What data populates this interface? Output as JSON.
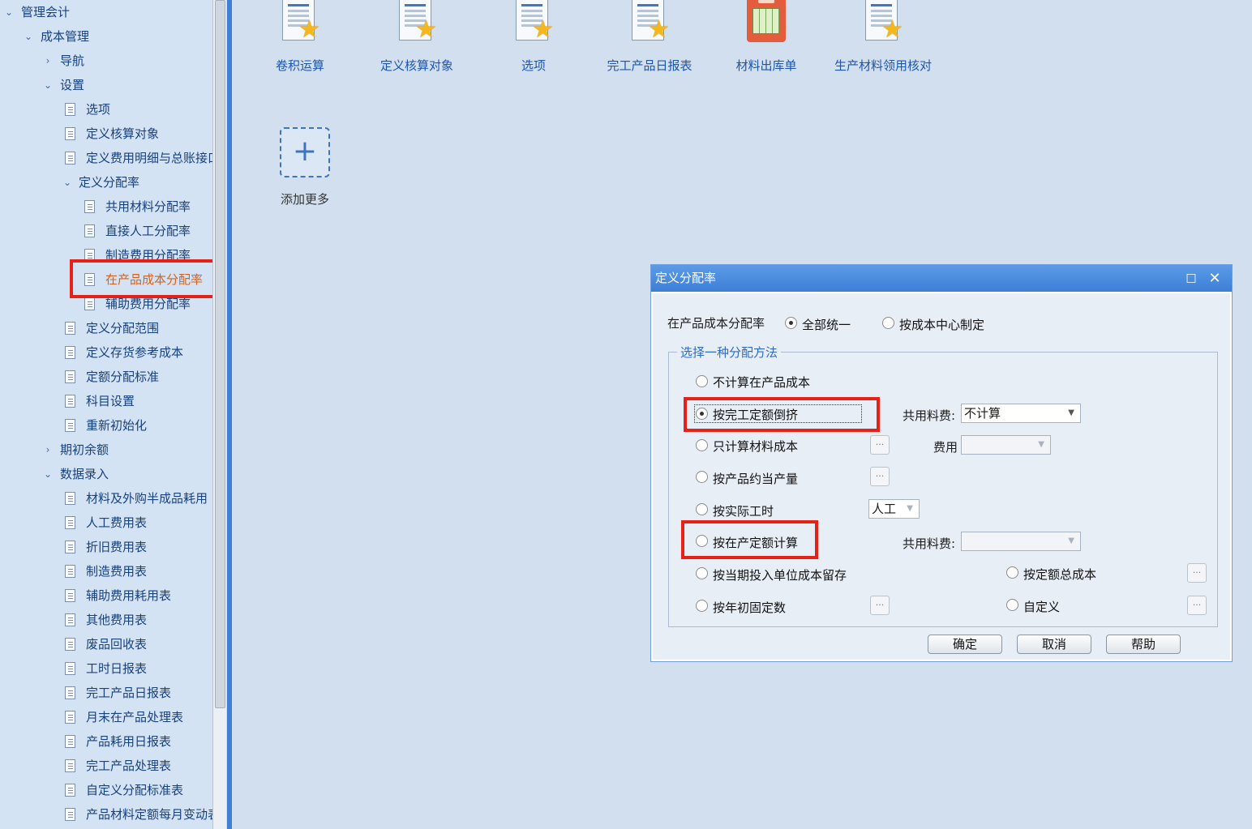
{
  "sidebar": {
    "items": [
      {
        "label": "管理会计",
        "arrow": "⌄"
      },
      {
        "label": "成本管理",
        "arrow": "⌄"
      },
      {
        "label": "导航",
        "arrow": "›"
      },
      {
        "label": "设置",
        "arrow": "⌄"
      },
      {
        "label": "选项"
      },
      {
        "label": "定义核算对象"
      },
      {
        "label": "定义费用明细与总账接口"
      },
      {
        "label": "定义分配率",
        "arrow": "⌄"
      },
      {
        "label": "共用材料分配率"
      },
      {
        "label": "直接人工分配率"
      },
      {
        "label": "制造费用分配率"
      },
      {
        "label": "在产品成本分配率"
      },
      {
        "label": "辅助费用分配率"
      },
      {
        "label": "定义分配范围"
      },
      {
        "label": "定义存货参考成本"
      },
      {
        "label": "定额分配标准"
      },
      {
        "label": "科目设置"
      },
      {
        "label": "重新初始化"
      },
      {
        "label": "期初余额",
        "arrow": "›"
      },
      {
        "label": "数据录入",
        "arrow": "⌄"
      },
      {
        "label": "材料及外购半成品耗用"
      },
      {
        "label": "人工费用表"
      },
      {
        "label": "折旧费用表"
      },
      {
        "label": "制造费用表"
      },
      {
        "label": "辅助费用耗用表"
      },
      {
        "label": "其他费用表"
      },
      {
        "label": "废品回收表"
      },
      {
        "label": "工时日报表"
      },
      {
        "label": "完工产品日报表"
      },
      {
        "label": "月末在产品处理表"
      },
      {
        "label": "产品耗用日报表"
      },
      {
        "label": "完工产品处理表"
      },
      {
        "label": "自定义分配标准表"
      },
      {
        "label": "产品材料定额每月变动表"
      }
    ]
  },
  "shortcuts": [
    {
      "label": "卷积运算",
      "icon": "document-star-icon"
    },
    {
      "label": "定义核算对象",
      "icon": "document-star-icon"
    },
    {
      "label": "选项",
      "icon": "document-star-icon"
    },
    {
      "label": "完工产品日报表",
      "icon": "document-star-icon"
    },
    {
      "label": "材料出库单",
      "icon": "calculator-sheet-icon"
    },
    {
      "label": "生产材料领用核对",
      "icon": "document-star-icon"
    }
  ],
  "add_more": {
    "icon": "+",
    "label": "添加更多"
  },
  "dialog": {
    "title": "定义分配率",
    "max_icon": "□",
    "close_icon": "✕",
    "rate_label": "在产品成本分配率",
    "scope_options": [
      {
        "label": "全部统一",
        "checked": true
      },
      {
        "label": "按成本中心制定",
        "checked": false
      }
    ],
    "group_title": "选择一种分配方法",
    "methods": [
      {
        "label": "不计算在产品成本",
        "checked": false
      },
      {
        "label": "按完工定额倒挤",
        "checked": true
      },
      {
        "label": "只计算材料成本",
        "checked": false
      },
      {
        "label": "按产品约当产量",
        "checked": false
      },
      {
        "label": "按实际工时",
        "checked": false
      },
      {
        "label": "按在产定额计算",
        "checked": false
      },
      {
        "label": "按当期投入单位成本留存",
        "checked": false
      },
      {
        "label": "按年初固定数",
        "checked": false
      },
      {
        "label": "按定额总成本",
        "checked": false
      },
      {
        "label": "自定义",
        "checked": false
      }
    ],
    "shared_material_label_1": "共用料费:",
    "shared_material_value_1": "不计算",
    "fee_label": "费用",
    "fee_value": "",
    "labor_value": "人工",
    "shared_material_label_2": "共用料费:",
    "shared_material_value_2": "",
    "ellipsis": "...",
    "caret": "▼",
    "buttons": {
      "ok": "确定",
      "cancel": "取消",
      "help": "帮助"
    }
  },
  "colors": {
    "highlight_red": "#e62117",
    "accent_blue": "#3d7fd6",
    "selected_text": "#d9601a"
  }
}
